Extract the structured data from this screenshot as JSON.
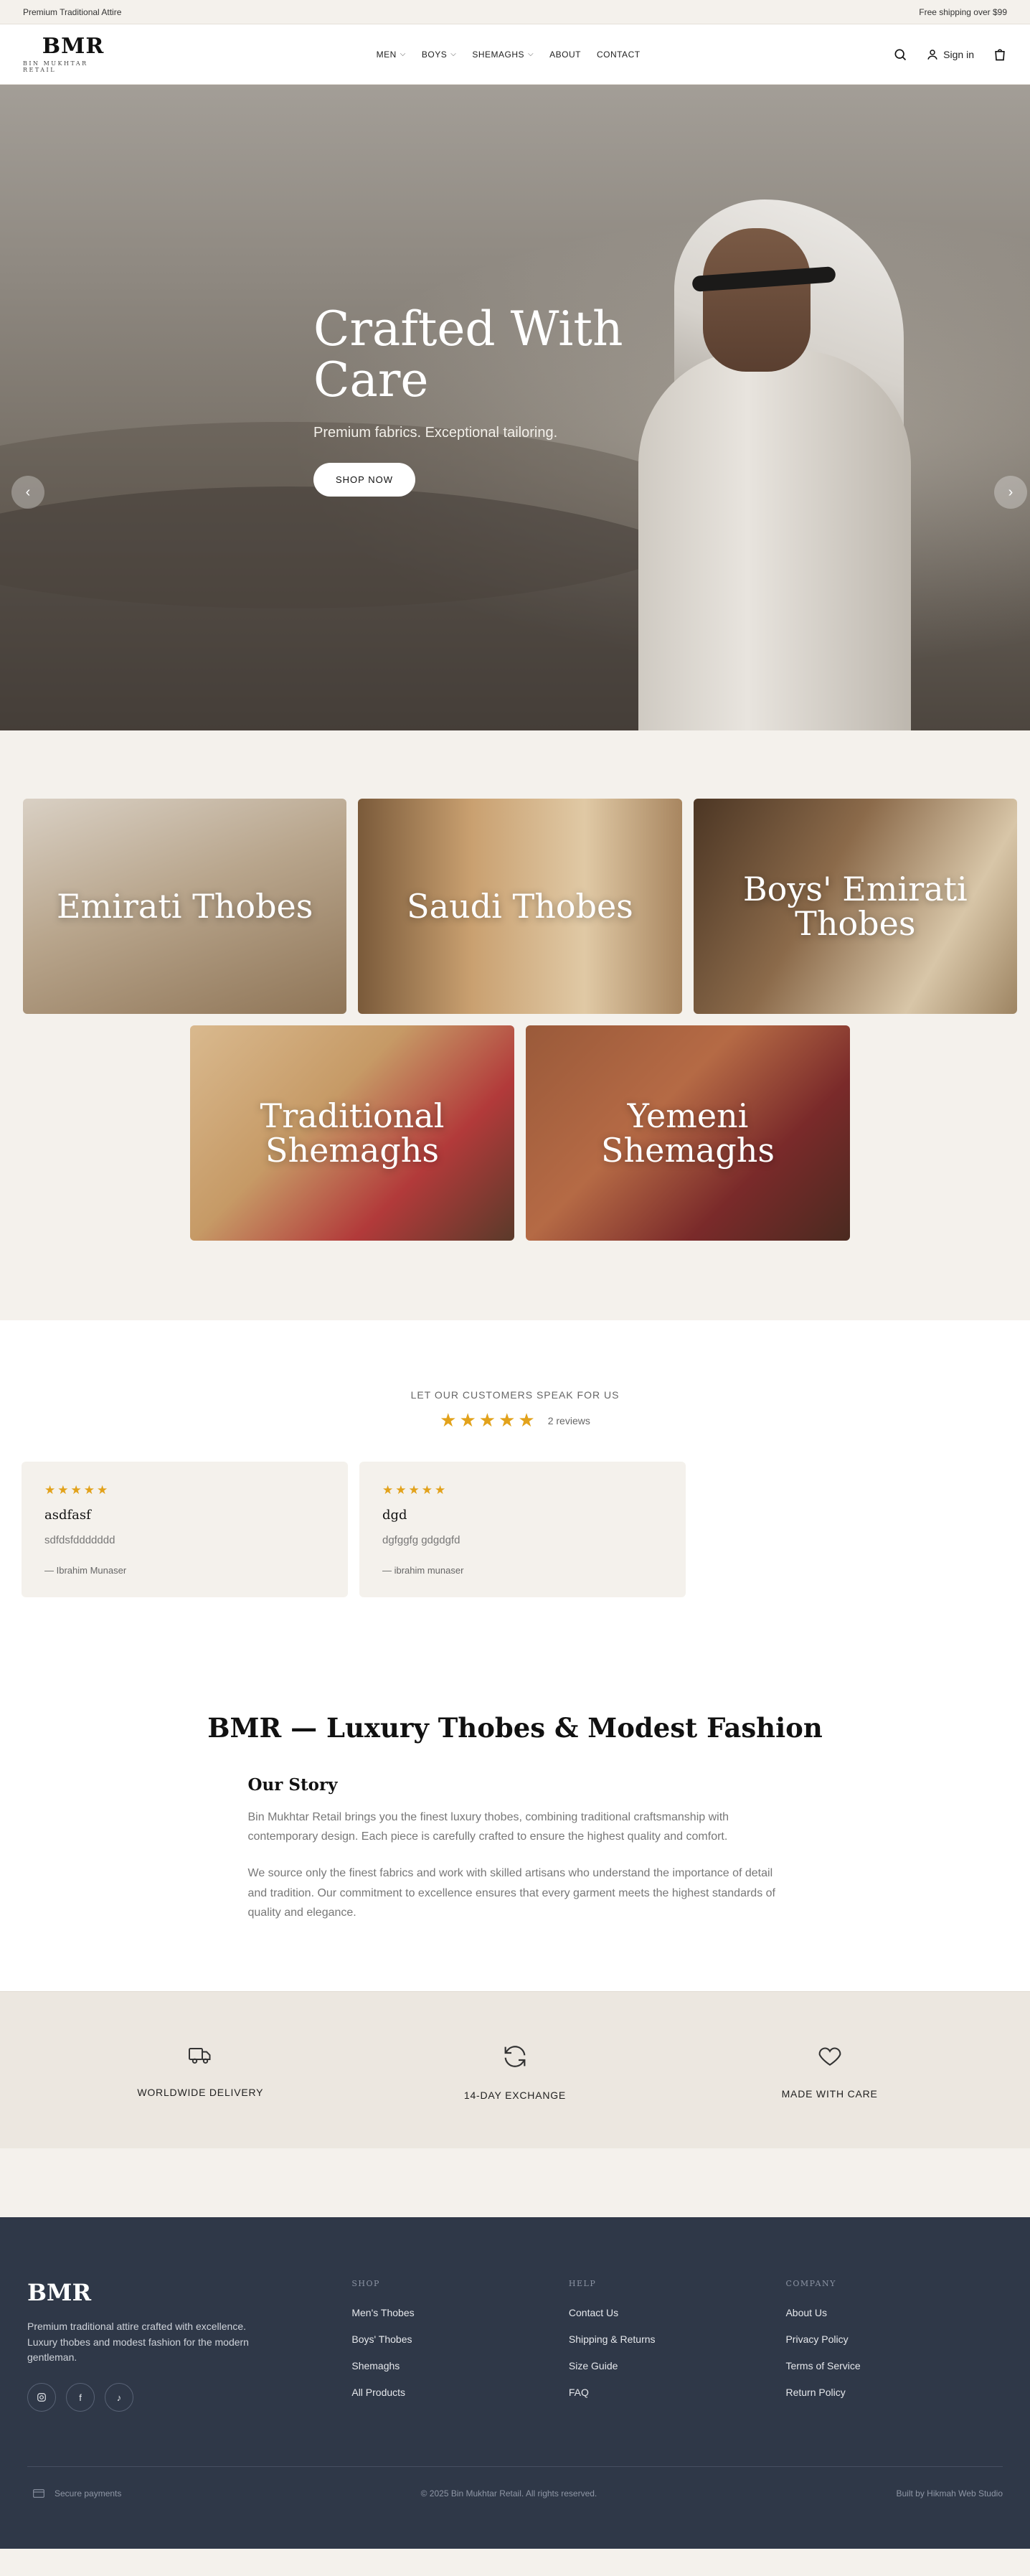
{
  "announcement": {
    "left": "Premium Traditional Attire",
    "right": "Free shipping over $99"
  },
  "header": {
    "logo": "BMR",
    "logo_sub": "BIN MUKHTAR RETAIL",
    "nav": [
      {
        "label": "MEN",
        "dropdown": true
      },
      {
        "label": "BOYS",
        "dropdown": true
      },
      {
        "label": "SHEMAGHS",
        "dropdown": true
      },
      {
        "label": "ABOUT",
        "dropdown": false
      },
      {
        "label": "CONTACT",
        "dropdown": false
      }
    ],
    "sign_in": "Sign in",
    "icons": {
      "search": "search-icon",
      "account": "user-icon",
      "cart": "bag-icon"
    }
  },
  "hero": {
    "title": "Crafted With Care",
    "subtitle": "Premium fabrics. Exceptional tailoring.",
    "cta": "SHOP NOW",
    "slides": 3,
    "active_slide": 2
  },
  "categories": [
    {
      "title": "Emirati Thobes"
    },
    {
      "title": "Saudi Thobes"
    },
    {
      "title": "Boys' Emirati Thobes"
    },
    {
      "title": "Traditional Shemaghs"
    },
    {
      "title": "Yemeni Shemaghs"
    }
  ],
  "reviews": {
    "heading": "LET OUR CUSTOMERS SPEAK FOR US",
    "rating": 5,
    "count_label": "2 reviews",
    "items": [
      {
        "rating": 5,
        "title": "asdfasf",
        "body": "sdfdsfddddddd",
        "author": "— Ibrahim Munaser"
      },
      {
        "rating": 5,
        "title": "dgd",
        "body": "dgfggfg gdgdgfd",
        "author": "— ibrahim munaser"
      }
    ]
  },
  "story": {
    "title": "BMR — Luxury Thobes & Modest Fashion",
    "heading": "Our Story",
    "paragraphs": [
      "Bin Mukhtar Retail brings you the finest luxury thobes, combining traditional craftsmanship with contemporary design. Each piece is carefully crafted to ensure the highest quality and comfort.",
      "We source only the finest fabrics and work with skilled artisans who understand the importance of detail and tradition. Our commitment to excellence ensures that every garment meets the highest standards of quality and elegance."
    ]
  },
  "features": [
    {
      "icon": "truck-icon",
      "label": "WORLDWIDE DELIVERY"
    },
    {
      "icon": "refresh-icon",
      "label": "14-DAY EXCHANGE"
    },
    {
      "icon": "heart-icon",
      "label": "MADE WITH CARE"
    }
  ],
  "footer": {
    "logo": "BMR",
    "description": "Premium traditional attire crafted with excellence. Luxury thobes and modest fashion for the modern gentleman.",
    "socials": [
      "instagram-icon",
      "facebook-icon",
      "tiktok-icon"
    ],
    "columns": [
      {
        "title": "SHOP",
        "links": [
          "Men's Thobes",
          "Boys' Thobes",
          "Shemaghs",
          "All Products"
        ]
      },
      {
        "title": "HELP",
        "links": [
          "Contact Us",
          "Shipping & Returns",
          "Size Guide",
          "FAQ"
        ]
      },
      {
        "title": "COMPANY",
        "links": [
          "About Us",
          "Privacy Policy",
          "Terms of Service",
          "Return Policy"
        ]
      }
    ],
    "secure": "Secure payments",
    "copyright": "© 2025 Bin Mukhtar Retail. All rights reserved.",
    "credit": "Built by Hikmah Web Studio"
  },
  "colors": {
    "accent_star": "#e2a21b",
    "footer_bg": "#2f3848",
    "page_bg": "#f4f1ec"
  }
}
